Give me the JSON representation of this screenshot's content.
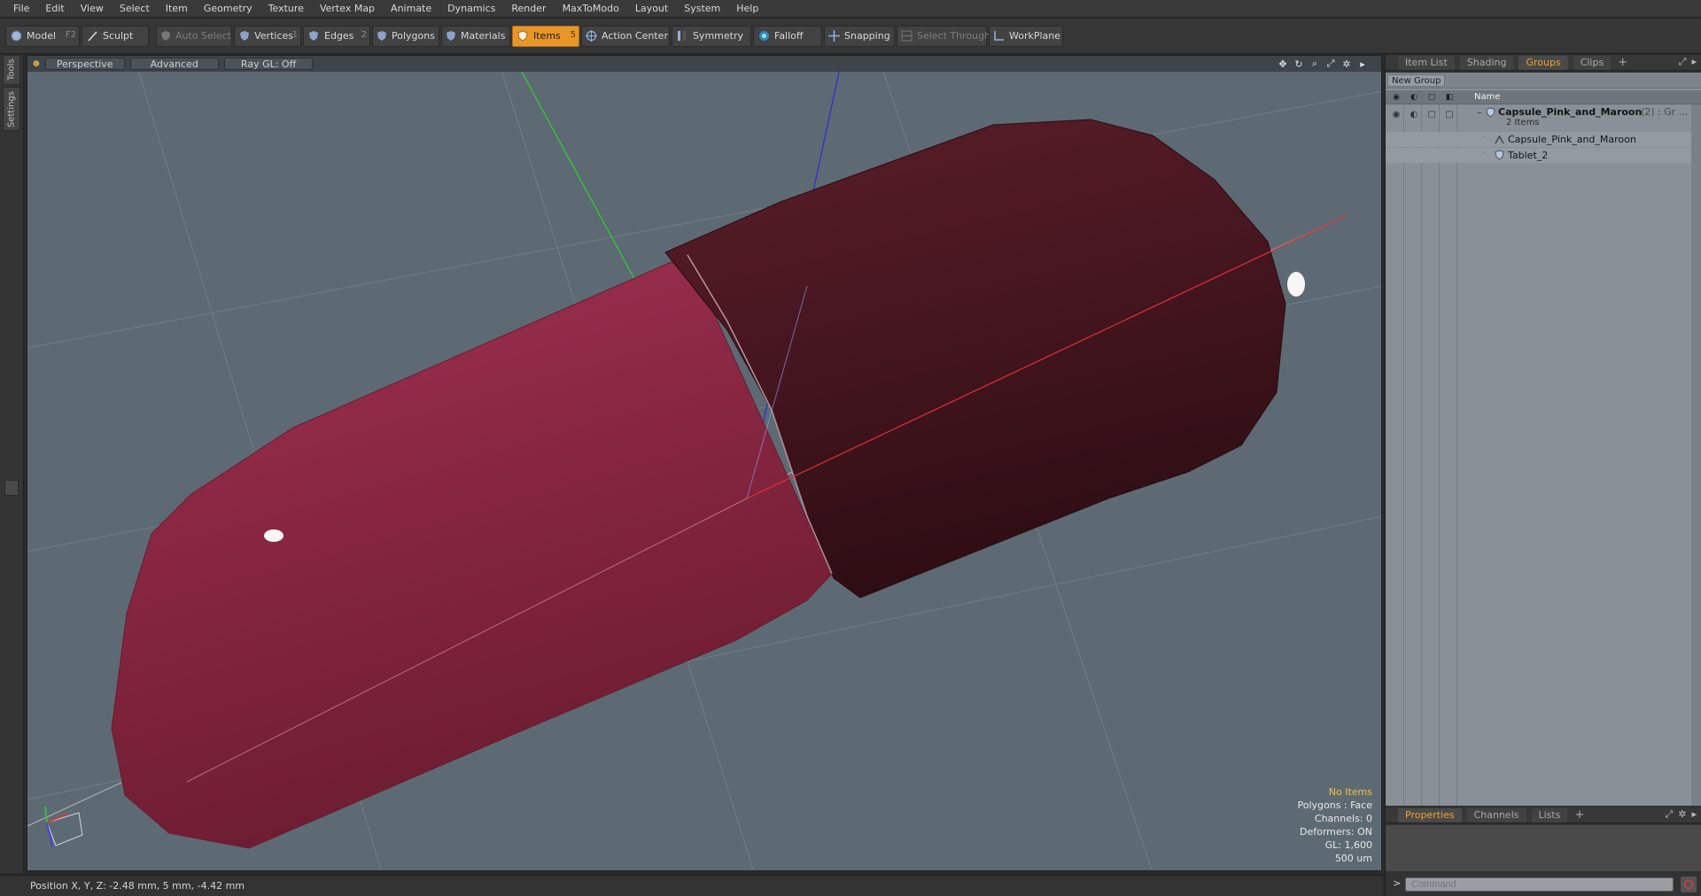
{
  "menu": [
    "File",
    "Edit",
    "View",
    "Select",
    "Item",
    "Geometry",
    "Texture",
    "Vertex Map",
    "Animate",
    "Dynamics",
    "Render",
    "MaxToModo",
    "Layout",
    "System",
    "Help"
  ],
  "toolbar": {
    "model": "Model",
    "model_key": "F2",
    "sculpt": "Sculpt",
    "auto_select": "Auto Select",
    "vertices": "Vertices",
    "vertices_key": "1",
    "edges": "Edges",
    "edges_key": "2",
    "polygons": "Polygons",
    "materials": "Materials",
    "items": "Items",
    "items_key": "5",
    "action_center": "Action Center",
    "symmetry": "Symmetry",
    "falloff": "Falloff",
    "snapping": "Snapping",
    "select_through": "Select Through",
    "workplane": "WorkPlane"
  },
  "left_tabs": {
    "tools": "Tools",
    "settings": "Settings"
  },
  "viewport": {
    "tabs": [
      "Perspective",
      "Advanced",
      "Ray GL: Off"
    ],
    "info": {
      "no_items": "No Items",
      "polygons": "Polygons : Face",
      "channels": "Channels: 0",
      "deformers": "Deformers: ON",
      "gl": "GL: 1,600",
      "scale": "500 um"
    }
  },
  "status": {
    "position": "Position X, Y, Z:   -2.48 mm, 5 mm, -4.42 mm"
  },
  "right_panel": {
    "tabs": [
      "Item List",
      "Shading",
      "Groups",
      "Clips"
    ],
    "active_tab": "Groups",
    "new_group": "New Group",
    "name_col": "Name",
    "group_name": "Capsule_Pink_and_Maroon",
    "group_suffix": "(2) : Gr ...",
    "group_count": "2 Items",
    "children": [
      "Capsule_Pink_and_Maroon",
      "Tablet_2"
    ]
  },
  "bottom_panel": {
    "tabs": [
      "Properties",
      "Channels",
      "Lists"
    ],
    "active_tab": "Properties",
    "command_placeholder": "Command"
  },
  "colors": {
    "accent": "#e8962a",
    "pink_capsule": "#8e2a45",
    "maroon_capsule": "#4a1720",
    "viewport_bg": "#5d6a73"
  }
}
